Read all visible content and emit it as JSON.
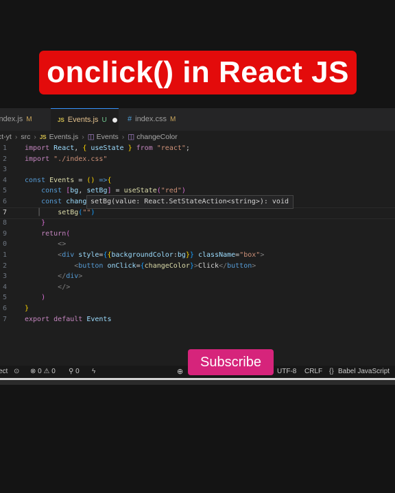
{
  "banner": {
    "title": "onclick() in React JS"
  },
  "tabs": [
    {
      "name": "index.js",
      "badge": "M",
      "icon": "js-icon"
    },
    {
      "name": "Events.js",
      "badge": "U",
      "icon": "js-icon",
      "active": true,
      "unsaved": true
    },
    {
      "name": "index.css",
      "badge": "M",
      "icon": "hash-icon"
    }
  ],
  "breadcrumb": {
    "root": "ct-yt",
    "folder": "src",
    "file": "Events.js",
    "component": "Events",
    "symbol": "changeColor"
  },
  "code": {
    "line_numbers": [
      "1",
      "2",
      "3",
      "4",
      "5",
      "6",
      "7",
      "8",
      "9",
      "0",
      "1",
      "2",
      "3",
      "4",
      "5",
      "6",
      "7"
    ],
    "current_line": 7
  },
  "hover_hint": {
    "text": "setBg(value: React.SetStateAction<string>): void"
  },
  "statusbar": {
    "left": "ect",
    "errors": "0",
    "warnings": "0",
    "ports": "0",
    "encoding": "UTF-8",
    "eol": "CRLF",
    "language": "Babel JavaScript"
  },
  "subscribe_label": "Subscribe",
  "colors": {
    "banner": "#e30b0b",
    "subscribe": "#d6247b",
    "editor_bg": "#1e1e1e"
  }
}
